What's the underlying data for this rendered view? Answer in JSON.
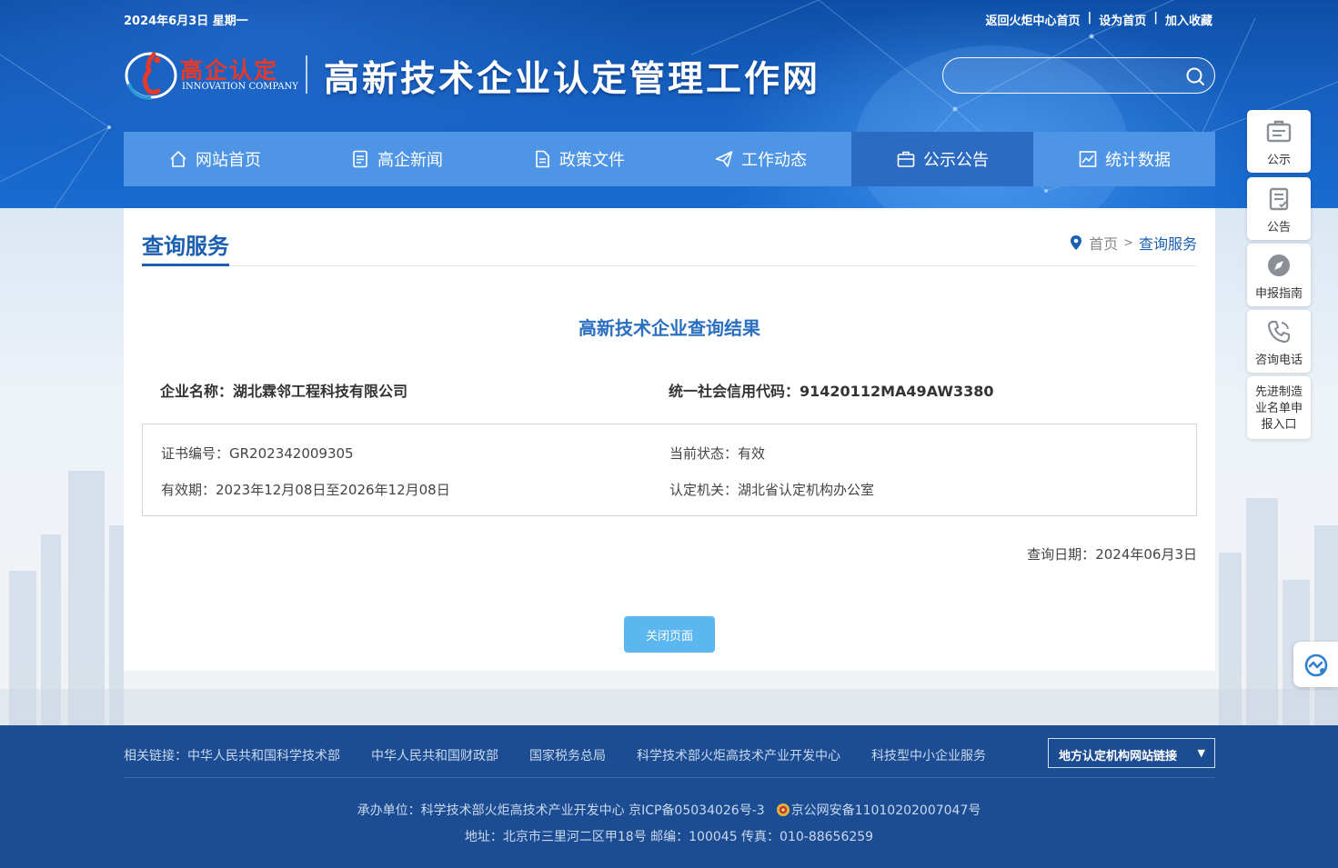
{
  "topbar": {
    "date": "2024年6月3日 星期一",
    "links": [
      "返回火炬中心首页",
      "设为首页",
      "加入收藏"
    ]
  },
  "logo": {
    "cn": "高企认定",
    "en": "INNOVATION COMPANY"
  },
  "site_title": "高新技术企业认定管理工作网",
  "search": {
    "value": "",
    "placeholder": ""
  },
  "nav": [
    {
      "label": "网站首页",
      "icon": "home-icon"
    },
    {
      "label": "高企新闻",
      "icon": "news-icon"
    },
    {
      "label": "政策文件",
      "icon": "document-icon"
    },
    {
      "label": "工作动态",
      "icon": "paper-plane-icon"
    },
    {
      "label": "公示公告",
      "icon": "briefcase-icon",
      "active": true
    },
    {
      "label": "统计数据",
      "icon": "chart-icon"
    }
  ],
  "panel": {
    "title": "查询服务",
    "breadcrumb": {
      "home": "首页",
      "sep": ">",
      "current": "查询服务"
    },
    "result_title": "高新技术企业查询结果",
    "company_label": "企业名称：",
    "company_value": "湖北霖邻工程科技有限公司",
    "credit_label": "统一社会信用代码：",
    "credit_value": "91420112MA49AW3380",
    "cert_label": "证书编号：",
    "cert_value": "GR202342009305",
    "status_label": "当前状态：",
    "status_value": "有效",
    "valid_label": "有效期：",
    "valid_value": "2023年12月08日至2026年12月08日",
    "authority_label": "认定机关：",
    "authority_value": "湖北省认定机构办公室",
    "query_date_label": "查询日期：",
    "query_date_value": "2024年06月3日",
    "close_button": "关闭页面"
  },
  "side": [
    {
      "label": "公示",
      "icon": "notice-board-icon"
    },
    {
      "label": "公告",
      "icon": "clipboard-icon"
    },
    {
      "label": "申报指南",
      "icon": "compass-icon"
    },
    {
      "label": "咨询电话",
      "icon": "phone-icon"
    },
    {
      "label": "先进制造业名单申报入口",
      "lines": [
        "先进制造",
        "业名单申",
        "报入口"
      ]
    }
  ],
  "footer": {
    "links_label": "相关链接：",
    "links": [
      "中华人民共和国科学技术部",
      "中华人民共和国财政部",
      "国家税务总局",
      "科学技术部火炬高技术产业开发中心",
      "科技型中小企业服务"
    ],
    "local_select": "地方认定机构网站链接",
    "line1_host": "承办单位：科学技术部火炬高技术产业开发中心 京ICP备05034026号-3",
    "line1_police": "京公网安备11010202007047号",
    "line2": "地址：北京市三里河二区甲18号 邮编：100045 传真：010-88656259"
  },
  "colors": {
    "nav": "#4f95e6",
    "nav_active": "#2b6bc1",
    "title_blue": "#1a5fb0",
    "button": "#5cb6f0",
    "footer": "#1c4d93"
  }
}
